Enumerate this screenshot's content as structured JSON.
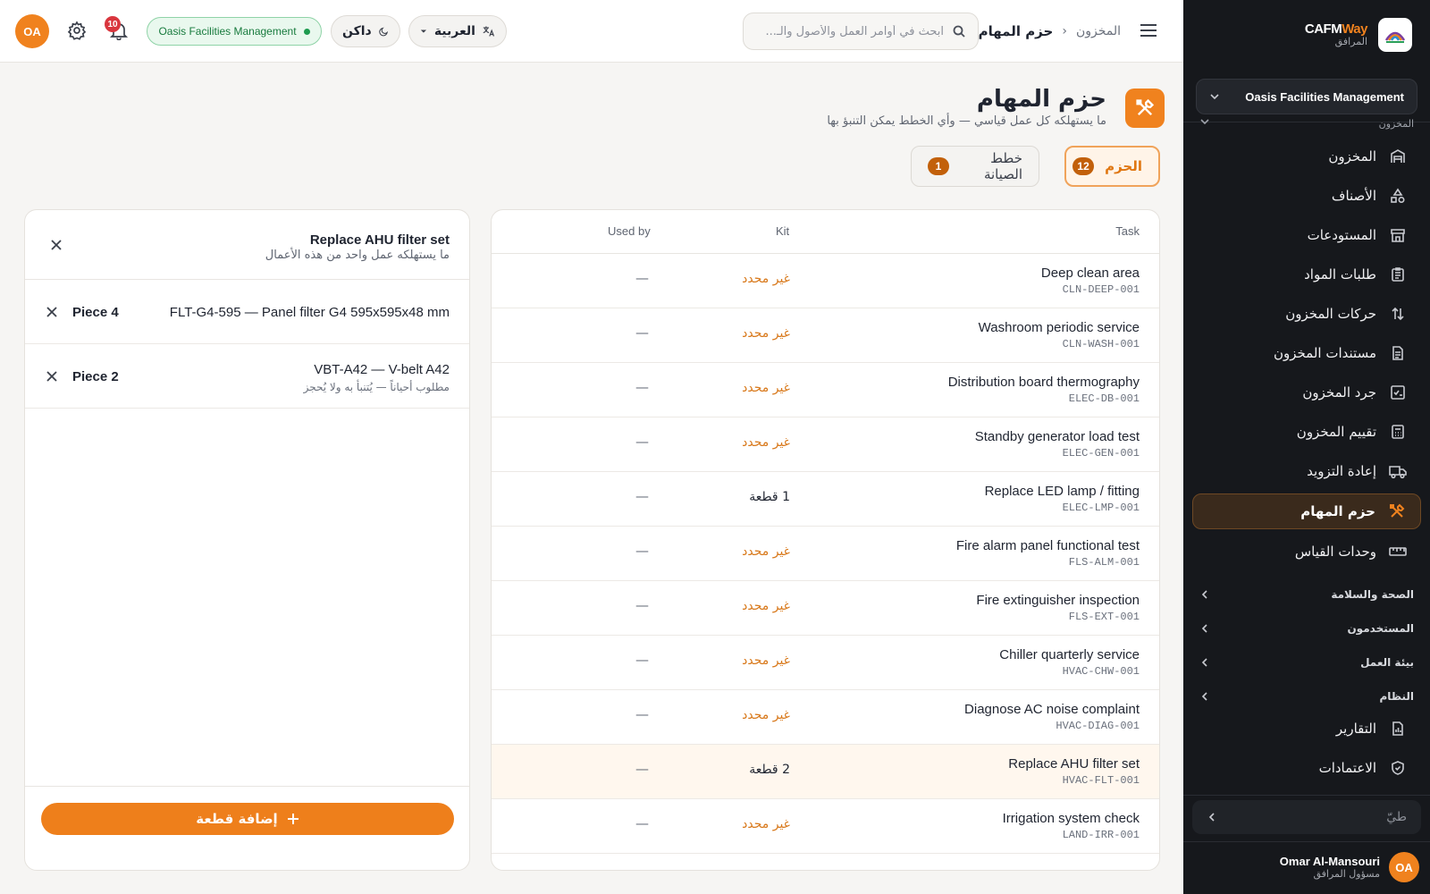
{
  "brand": {
    "name_part1": "CAFM",
    "name_part2": "Way",
    "subtitle": "المرافق"
  },
  "org_selector": {
    "label": "Oasis Facilities Management"
  },
  "sidebar": {
    "group_top": "المخزون",
    "items": [
      {
        "label": "المخزون",
        "icon": "warehouse-icon"
      },
      {
        "label": "الأصناف",
        "icon": "shapes-icon"
      },
      {
        "label": "المستودعات",
        "icon": "store-icon"
      },
      {
        "label": "طلبات المواد",
        "icon": "clipboard-list-icon"
      },
      {
        "label": "حركات المخزون",
        "icon": "arrows-up-down-icon"
      },
      {
        "label": "مستندات المخزون",
        "icon": "document-icon"
      },
      {
        "label": "جرد المخزون",
        "icon": "checklist-icon"
      },
      {
        "label": "تقييم المخزون",
        "icon": "calculator-icon"
      },
      {
        "label": "إعادة التزويد",
        "icon": "truck-icon"
      },
      {
        "label": "حزم المهام",
        "icon": "tools-icon",
        "active": true
      },
      {
        "label": "وحدات القياس",
        "icon": "ruler-icon"
      }
    ],
    "groups": [
      "الصحة والسلامة",
      "المستخدمون",
      "بيئة العمل",
      "النظام"
    ],
    "bottom_items": [
      {
        "label": "التقارير",
        "icon": "report-icon"
      },
      {
        "label": "الاعتمادات",
        "icon": "shield-check-icon"
      }
    ],
    "search_placeholder": "طيّ",
    "user": {
      "initials": "OA",
      "name": "Omar Al-Mansouri",
      "role": "مسؤول المرافق"
    }
  },
  "topbar": {
    "breadcrumb": {
      "parent": "المخزون",
      "current": "حزم المهام"
    },
    "search_placeholder": "ابحث في أوامر العمل والأصول والـ...",
    "language": "العربية",
    "theme": "داكن",
    "org": "Oasis Facilities Management",
    "notifications_count": "10",
    "avatar_initials": "OA"
  },
  "page": {
    "title": "حزم المهام",
    "subtitle": "ما يستهلكه كل عمل قياسي — وأي الخطط يمكن التنبؤ بها",
    "tabs": [
      {
        "label": "الحزم",
        "count": "12"
      },
      {
        "label": "خطط الصيانة",
        "count": "1"
      }
    ]
  },
  "table": {
    "headers": {
      "task": "Task",
      "kit": "Kit",
      "used_by": "Used by"
    },
    "rows": [
      {
        "name": "Deep clean area",
        "code": "CLN-DEEP-001",
        "kit": "غير محدد",
        "kit_set": false,
        "used_by": "—"
      },
      {
        "name": "Washroom periodic service",
        "code": "CLN-WASH-001",
        "kit": "غير محدد",
        "kit_set": false,
        "used_by": "—"
      },
      {
        "name": "Distribution board thermography",
        "code": "ELEC-DB-001",
        "kit": "غير محدد",
        "kit_set": false,
        "used_by": "—"
      },
      {
        "name": "Standby generator load test",
        "code": "ELEC-GEN-001",
        "kit": "غير محدد",
        "kit_set": false,
        "used_by": "—"
      },
      {
        "name": "Replace LED lamp / fitting",
        "code": "ELEC-LMP-001",
        "kit": "1 قطعة",
        "kit_set": true,
        "used_by": "—"
      },
      {
        "name": "Fire alarm panel functional test",
        "code": "FLS-ALM-001",
        "kit": "غير محدد",
        "kit_set": false,
        "used_by": "—"
      },
      {
        "name": "Fire extinguisher inspection",
        "code": "FLS-EXT-001",
        "kit": "غير محدد",
        "kit_set": false,
        "used_by": "—"
      },
      {
        "name": "Chiller quarterly service",
        "code": "HVAC-CHW-001",
        "kit": "غير محدد",
        "kit_set": false,
        "used_by": "—"
      },
      {
        "name": "Diagnose AC noise complaint",
        "code": "HVAC-DIAG-001",
        "kit": "غير محدد",
        "kit_set": false,
        "used_by": "—"
      },
      {
        "name": "Replace AHU filter set",
        "code": "HVAC-FLT-001",
        "kit": "2 قطعة",
        "kit_set": true,
        "used_by": "—",
        "selected": true
      },
      {
        "name": "Irrigation system check",
        "code": "LAND-IRR-001",
        "kit": "غير محدد",
        "kit_set": false,
        "used_by": "—"
      }
    ]
  },
  "detail": {
    "title": "Replace AHU filter set",
    "subtitle": "ما يستهلكه عمل واحد من هذه الأعمال",
    "parts": [
      {
        "name": "FLT-G4-595 — Panel filter G4 595x595x48 mm",
        "note": "",
        "qty": "Piece 4"
      },
      {
        "name": "VBT-A42 — V-belt A42",
        "note": "مطلوب أحياناً — يُتنبأ به ولا يُحجز",
        "qty": "Piece 2"
      }
    ],
    "add_button": "إضافة قطعة"
  },
  "colors": {
    "accent": "#f0821e",
    "sidebar_bg": "#16181c",
    "kit_unset": "#d8781a",
    "success": "#1e9b4f",
    "danger": "#d9363e"
  }
}
